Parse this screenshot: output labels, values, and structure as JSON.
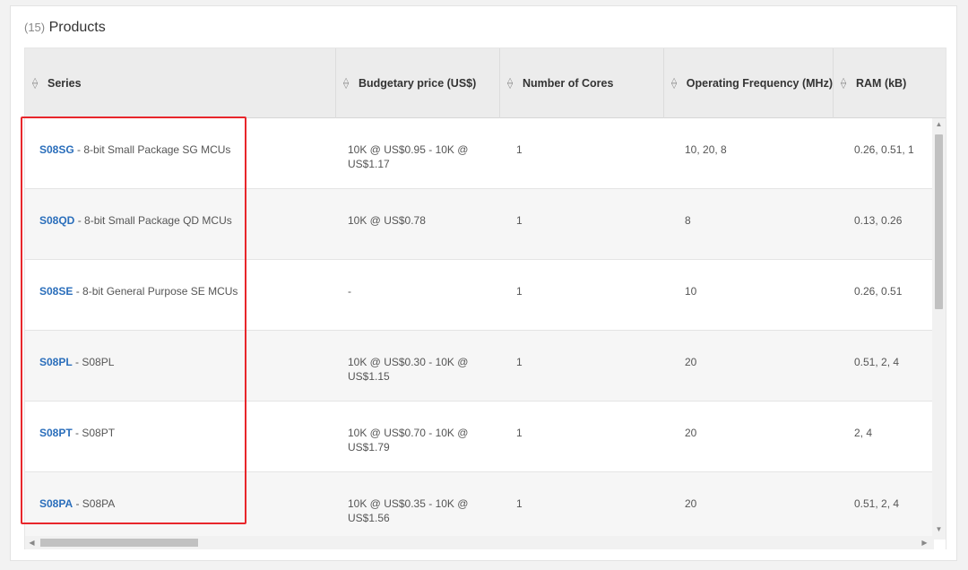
{
  "heading": {
    "count": "(15)",
    "title": "Products"
  },
  "columns": [
    {
      "label": "Series"
    },
    {
      "label": "Budgetary price (US$)"
    },
    {
      "label": "Number of Cores"
    },
    {
      "label": "Operating Frequency (MHz)"
    },
    {
      "label": "RAM (kB)"
    }
  ],
  "rows": [
    {
      "code": "S08SG",
      "desc": " - 8-bit Small Package SG MCUs",
      "price_1": "10K @ US$0.95 - 10K @",
      "price_2": "US$1.17",
      "cores": "1",
      "freq": "10, 20, 8",
      "ram": "0.26, 0.51, 1"
    },
    {
      "code": "S08QD",
      "desc": " - 8-bit Small Package QD MCUs",
      "price_1": "10K @ US$0.78",
      "price_2": "",
      "cores": "1",
      "freq": "8",
      "ram": "0.13, 0.26"
    },
    {
      "code": "S08SE",
      "desc": " - 8-bit General Purpose SE MCUs",
      "price_1": "-",
      "price_2": "",
      "cores": "1",
      "freq": "10",
      "ram": "0.26, 0.51"
    },
    {
      "code": "S08PL",
      "desc": " - S08PL",
      "price_1": "10K @ US$0.30 - 10K @",
      "price_2": "US$1.15",
      "cores": "1",
      "freq": "20",
      "ram": "0.51, 2, 4"
    },
    {
      "code": "S08PT",
      "desc": " - S08PT",
      "price_1": "10K @ US$0.70 - 10K @",
      "price_2": "US$1.79",
      "cores": "1",
      "freq": "20",
      "ram": "2, 4"
    },
    {
      "code": "S08PA",
      "desc": " - S08PA",
      "price_1": "10K @ US$0.35 - 10K @",
      "price_2": "US$1.56",
      "cores": "1",
      "freq": "20",
      "ram": "0.51, 2, 4"
    }
  ],
  "icons": {
    "sort": "sort-icon",
    "scroll_up": "chevron-up-icon",
    "scroll_down": "chevron-down-icon",
    "scroll_left": "chevron-left-icon",
    "scroll_right": "chevron-right-icon"
  },
  "colors": {
    "link": "#2a6ebb",
    "highlight": "#e8262b",
    "header_bg": "#ececec"
  }
}
